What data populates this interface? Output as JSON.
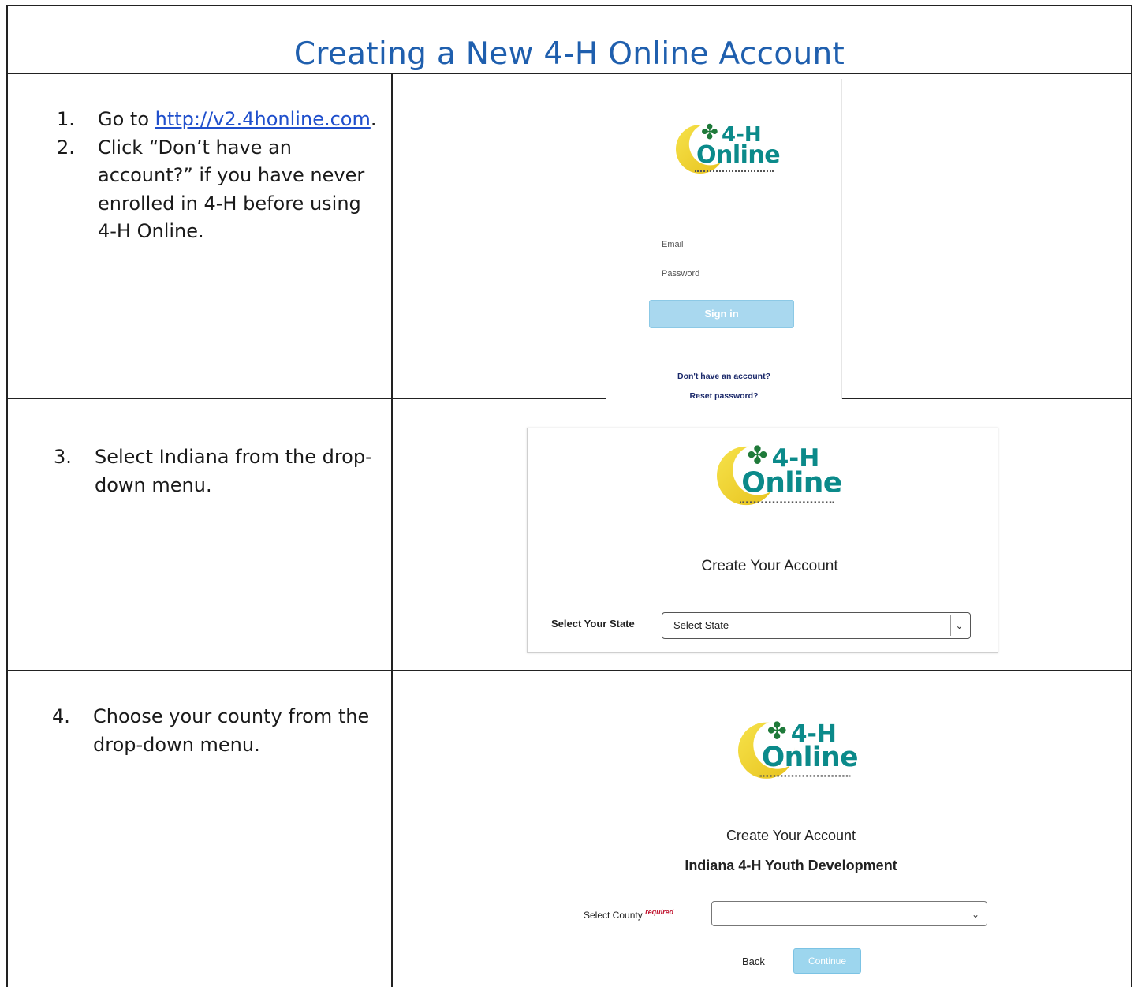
{
  "title": "Creating a New 4-H Online Account",
  "logo": {
    "line1": "4-H",
    "line2": "Online"
  },
  "row1": {
    "steps": [
      {
        "num": "1.",
        "pre": "Go to ",
        "link": "http://v2.4honline.com",
        "post": "."
      },
      {
        "num": "2.",
        "text": "Click “Don’t have an account?” if you have never enrolled in 4-H before using 4-H Online."
      }
    ],
    "screen": {
      "email_label": "Email",
      "password_label": "Password",
      "signin_label": "Sign in",
      "no_account_link": "Don't have an account?",
      "reset_link": "Reset password?"
    }
  },
  "row2": {
    "step": {
      "num": "3.",
      "text": "Select Indiana from the drop-down menu."
    },
    "screen": {
      "heading": "Create Your Account",
      "select_label": "Select Your State",
      "select_value": "Select State"
    }
  },
  "row3": {
    "step": {
      "num": "4.",
      "text": "Choose your county from the drop-down menu."
    },
    "screen": {
      "heading": "Create Your Account",
      "subheading": "Indiana 4-H Youth Development",
      "select_label": "Select County",
      "required_label": "required",
      "select_value": "",
      "back_label": "Back",
      "continue_label": "Continue"
    }
  }
}
